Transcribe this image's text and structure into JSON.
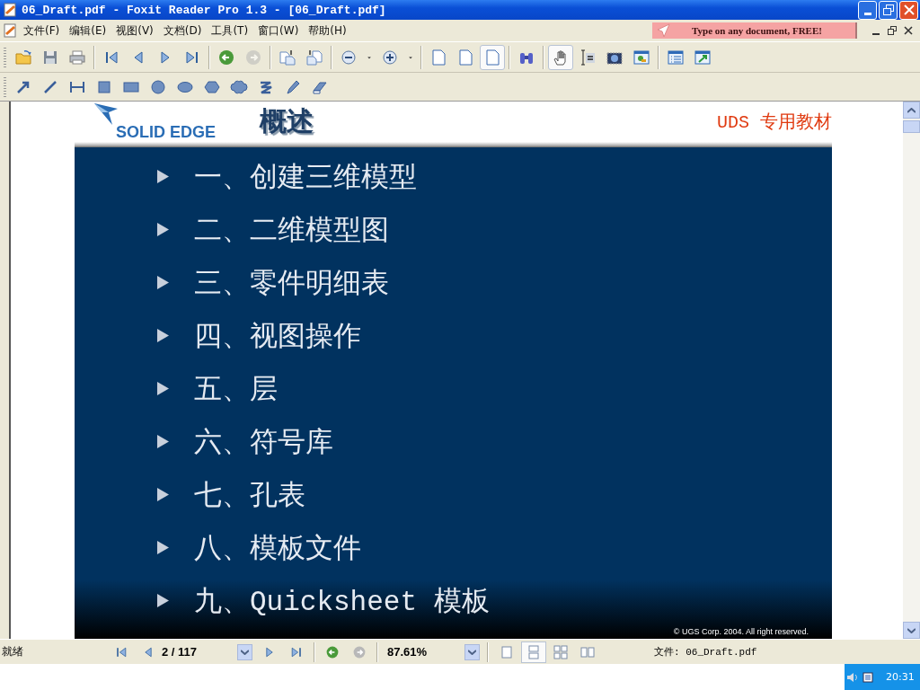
{
  "window": {
    "title": "06_Draft.pdf - Foxit Reader Pro 1.3 - [06_Draft.pdf]"
  },
  "menu": [
    "文件(F)",
    "编辑(E)",
    "视图(V)",
    "文档(D)",
    "工具(T)",
    "窗口(W)",
    "帮助(H)"
  ],
  "ad_banner": {
    "text": "Type on any document, FREE!"
  },
  "toolbar": [
    {
      "kind": "open",
      "selected": false,
      "disabled": false
    },
    {
      "kind": "save",
      "selected": false,
      "disabled": false
    },
    {
      "kind": "print",
      "selected": false,
      "disabled": false
    },
    {
      "kind": "sep"
    },
    {
      "kind": "first",
      "selected": false,
      "disabled": false
    },
    {
      "kind": "prev",
      "selected": false,
      "disabled": false
    },
    {
      "kind": "next",
      "selected": false,
      "disabled": false
    },
    {
      "kind": "last",
      "selected": false,
      "disabled": false
    },
    {
      "kind": "sep"
    },
    {
      "kind": "back",
      "selected": false,
      "disabled": false
    },
    {
      "kind": "forward",
      "selected": false,
      "disabled": true
    },
    {
      "kind": "sep"
    },
    {
      "kind": "rotcw",
      "selected": false,
      "disabled": false
    },
    {
      "kind": "rotccw",
      "selected": false,
      "disabled": false
    },
    {
      "kind": "sep"
    },
    {
      "kind": "zoomout",
      "selected": false,
      "disabled": false
    },
    {
      "kind": "caret",
      "selected": false,
      "disabled": false
    },
    {
      "kind": "zoomin",
      "selected": false,
      "disabled": false
    },
    {
      "kind": "caret",
      "selected": false,
      "disabled": false
    },
    {
      "kind": "sep"
    },
    {
      "kind": "page",
      "selected": false,
      "disabled": false
    },
    {
      "kind": "page",
      "selected": false,
      "disabled": false
    },
    {
      "kind": "page",
      "selected": true,
      "disabled": false
    },
    {
      "kind": "sep"
    },
    {
      "kind": "find",
      "selected": false,
      "disabled": false
    },
    {
      "kind": "sep"
    },
    {
      "kind": "hand",
      "selected": true,
      "disabled": false
    },
    {
      "kind": "textsel",
      "selected": false,
      "disabled": false
    },
    {
      "kind": "camera",
      "selected": false,
      "disabled": false
    },
    {
      "kind": "image",
      "selected": false,
      "disabled": false
    },
    {
      "kind": "sep"
    },
    {
      "kind": "list",
      "selected": false,
      "disabled": false
    },
    {
      "kind": "export",
      "selected": false,
      "disabled": false
    }
  ],
  "draw_toolbar": [
    {
      "kind": "arrow"
    },
    {
      "kind": "line"
    },
    {
      "kind": "dimension"
    },
    {
      "kind": "square"
    },
    {
      "kind": "rectangle"
    },
    {
      "kind": "circle"
    },
    {
      "kind": "ellipse"
    },
    {
      "kind": "hexagon"
    },
    {
      "kind": "cloud"
    },
    {
      "kind": "squiggle"
    },
    {
      "kind": "pencil"
    },
    {
      "kind": "eraser"
    }
  ],
  "document": {
    "logo": "SOLID EDGE",
    "title": "概述",
    "tag": "UDS 专用教材",
    "items": [
      "一、创建三维模型",
      "二、二维模型图",
      "三、零件明细表",
      "四、视图操作",
      "五、层",
      "六、符号库",
      "七、孔表",
      "八、模板文件",
      "九、Quicksheet 模板"
    ],
    "copyright": "© UGS Corp. 2004. All right reserved."
  },
  "status_bar": {
    "status": "就绪",
    "page": "2 / 117",
    "zoom": "87.61%",
    "views": [
      {
        "kind": "single",
        "selected": false
      },
      {
        "kind": "continuous",
        "selected": true
      },
      {
        "kind": "facing",
        "selected": false
      },
      {
        "kind": "cover",
        "selected": false
      }
    ],
    "file": "文件: 06_Draft.pdf"
  },
  "tray": {
    "clock": "20:31"
  }
}
